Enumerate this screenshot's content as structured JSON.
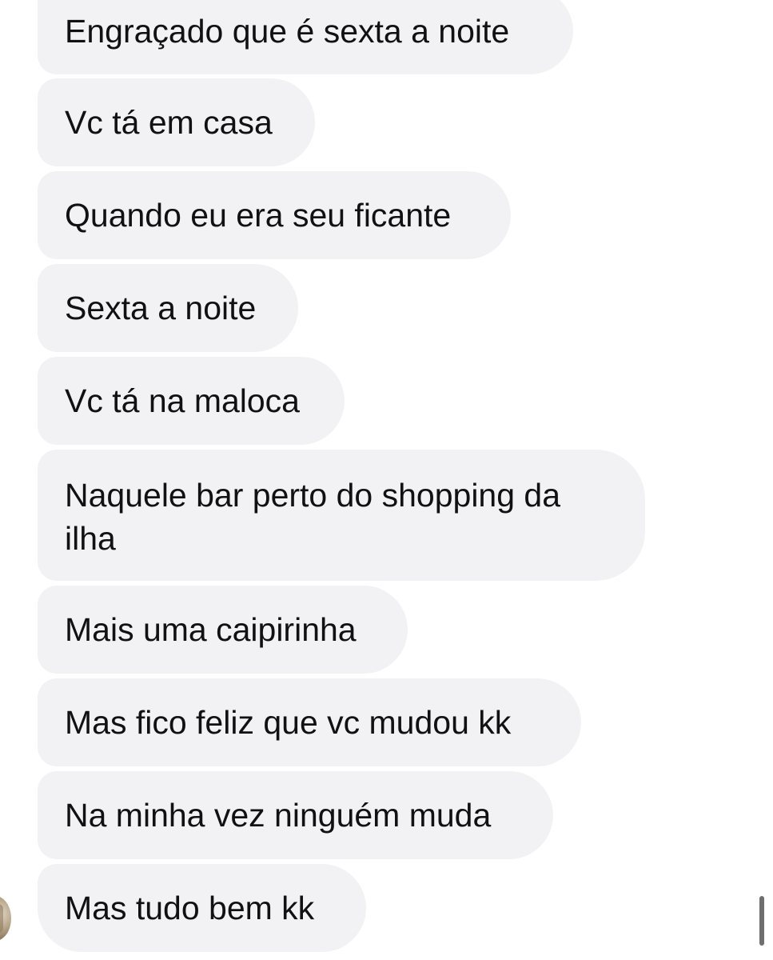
{
  "messages": [
    {
      "text": "Engraçado que é sexta a noite"
    },
    {
      "text": "Vc tá em casa"
    },
    {
      "text": "Quando eu era seu ficante"
    },
    {
      "text": "Sexta a noite"
    },
    {
      "text": "Vc tá na maloca"
    },
    {
      "lines": [
        "Naquele bar perto do shopping da",
        "ilha"
      ]
    },
    {
      "text": "Mais uma caipirinha"
    },
    {
      "text": "Mas fico feliz que vc mudou kk"
    },
    {
      "text": "Na minha vez ninguém muda"
    },
    {
      "text": "Mas tudo bem kk"
    }
  ],
  "colors": {
    "background": "#ffffff",
    "bubble": "#f2f2f5",
    "text": "#111111"
  }
}
